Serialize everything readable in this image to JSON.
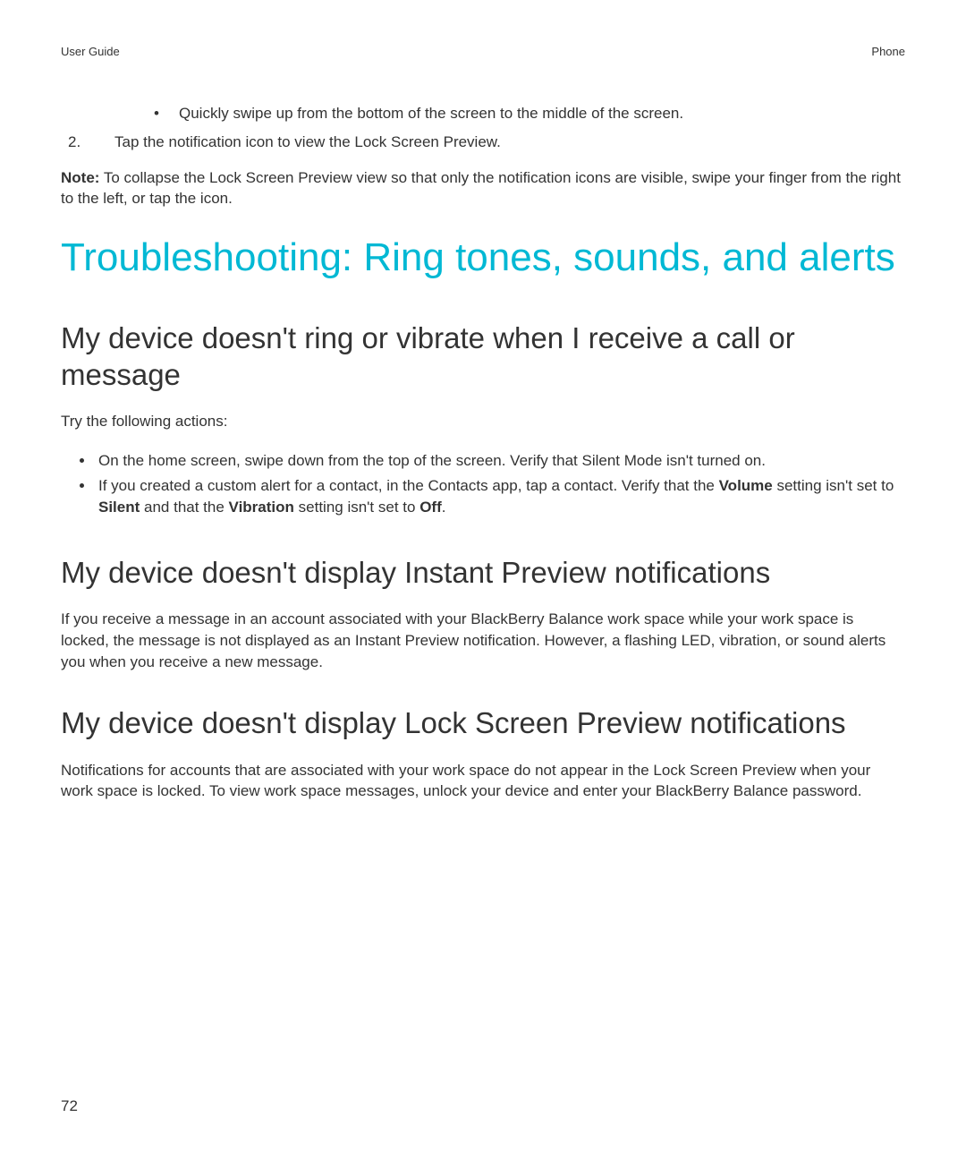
{
  "header": {
    "left": "User Guide",
    "right": "Phone"
  },
  "intro": {
    "bullet_text": "Quickly swipe up from the bottom of the screen to the middle of the screen.",
    "step_number": "2.",
    "step_text": "Tap the notification icon to view the Lock Screen Preview."
  },
  "note": {
    "label": "Note:",
    "text": " To collapse the Lock Screen Preview view so that only the notification icons are visible, swipe your finger from the right to the left, or tap the icon."
  },
  "main_heading": "Troubleshooting: Ring tones, sounds, and alerts",
  "section1": {
    "heading": "My device doesn't ring or vibrate when I receive a call or message",
    "intro": "Try the following actions:",
    "bullets": {
      "b1": "On the home screen, swipe down from the top of the screen. Verify that Silent Mode isn't turned on.",
      "b2_pre": "If you created a custom alert for a contact, in the Contacts app, tap a contact. Verify that the ",
      "b2_bold1": "Volume",
      "b2_mid": " setting isn't set to ",
      "b2_bold2": "Silent",
      "b2_mid2": " and that the ",
      "b2_bold3": "Vibration",
      "b2_post": " setting isn't set to ",
      "b2_bold4": "Off",
      "b2_end": "."
    }
  },
  "section2": {
    "heading": "My device doesn't display Instant Preview notifications",
    "para": "If you receive a message in an account associated with your BlackBerry Balance work space while your work space is locked, the message is not displayed as an Instant Preview notification. However, a flashing LED, vibration, or sound alerts you when you receive a new message."
  },
  "section3": {
    "heading": "My device doesn't display Lock Screen Preview notifications",
    "para": "Notifications for accounts that are associated with your work space do not appear in the Lock Screen Preview when your work space is locked. To view work space messages, unlock your device and enter your BlackBerry Balance password."
  },
  "page_number": "72"
}
